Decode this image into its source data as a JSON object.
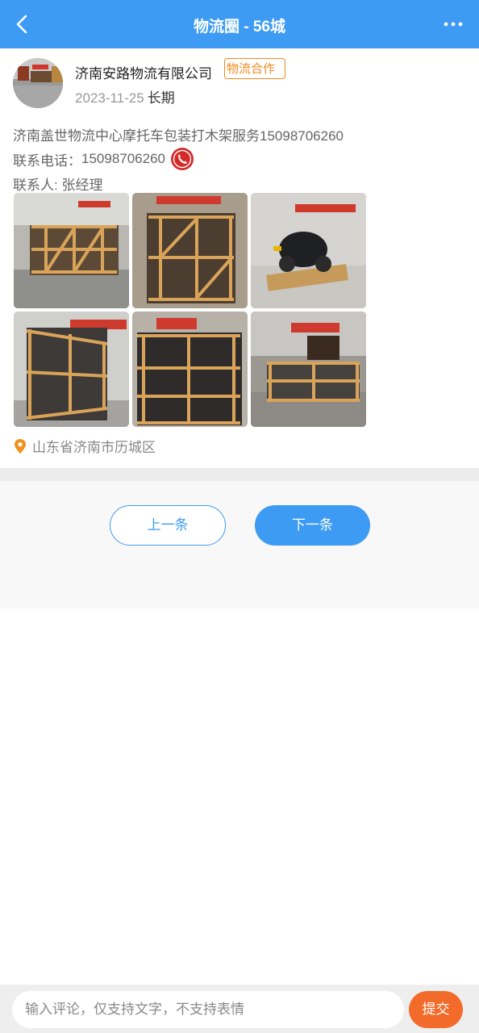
{
  "header": {
    "title": "物流圈 - 56城",
    "back_icon": "back-chevron-icon",
    "more_icon": "more-dots-icon",
    "bg_color": "#3d9bf3"
  },
  "post": {
    "company": "济南安路物流有限公司",
    "tag": "物流合作",
    "date": "2023-11-25",
    "term": "长期",
    "description": "济南盖世物流中心摩托车包装打木架服务15098706260",
    "phone_label": "联系电话：",
    "phone": "15098706260",
    "phone_icon": "phone-call-icon",
    "contact_label": "联系人: ",
    "contact": "张经理",
    "photo_count": 6,
    "location": "山东省济南市历城区",
    "location_icon": "location-pin-icon"
  },
  "nav": {
    "prev_label": "上一条",
    "next_label": "下一条"
  },
  "comment": {
    "placeholder": "输入评论，仅支持文字，不支持表情",
    "submit_label": "提交"
  },
  "colors": {
    "primary": "#3d9bf3",
    "accent": "#f08a1c",
    "submit": "#f36b2a"
  }
}
